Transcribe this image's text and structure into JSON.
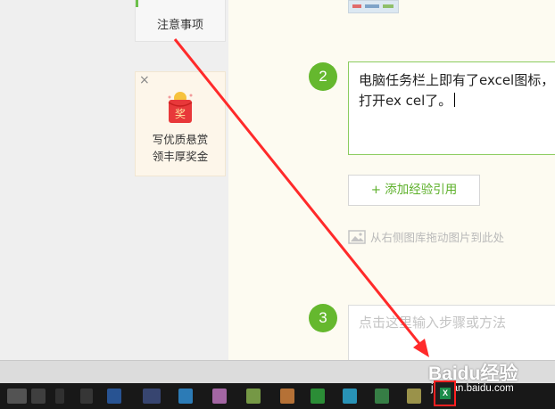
{
  "left_panel": {
    "nav_item": "注意事项",
    "reward": {
      "close_glyph": "×",
      "envelope_char": "奖",
      "line1": "写优质悬赏",
      "line2": "领丰厚奖金"
    }
  },
  "steps": [
    {
      "number": "2",
      "text": "电脑任务栏上即有了excel图标，打开ex cel了。"
    },
    {
      "number": "3",
      "placeholder": "点击这里输入步骤或方法"
    }
  ],
  "add_quote_button": "+ 添加经验引用",
  "drag_hint": "从右侧图库拖动图片到此处",
  "watermark": {
    "logo": "Baidu经验",
    "url": "jingyan.baidu.com"
  },
  "colors": {
    "accent_green": "#65b82e",
    "arrow_red": "#ff2020",
    "taskbar": "#181818"
  },
  "icons": [
    "close-icon",
    "red-envelope-icon",
    "image-icon",
    "excel-icon"
  ]
}
